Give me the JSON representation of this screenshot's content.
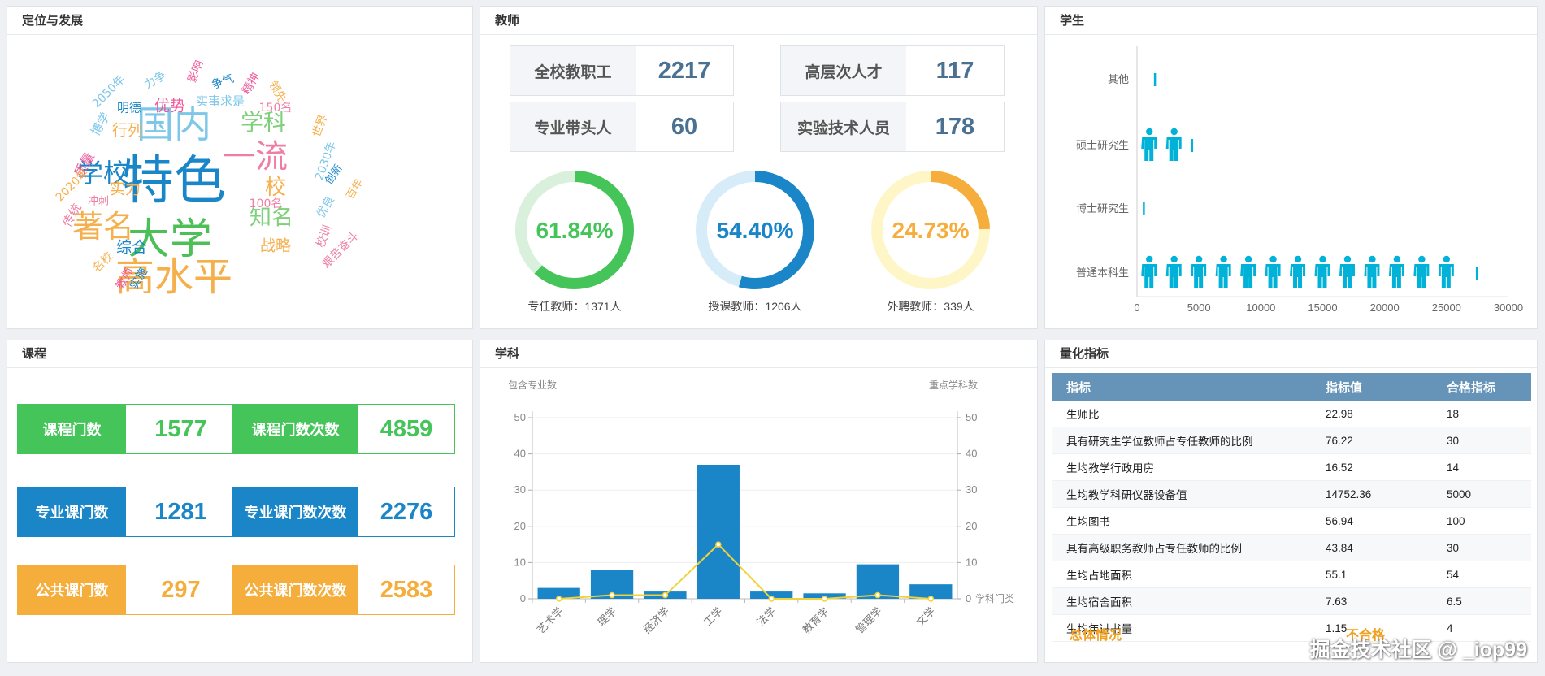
{
  "positioning": {
    "title": "定位与发展",
    "words": [
      {
        "text": "特色",
        "color": "#1a86c8"
      },
      {
        "text": "大学",
        "color": "#4cbf57"
      },
      {
        "text": "高水平",
        "color": "#f5b04d"
      },
      {
        "text": "国内",
        "color": "#7ec7e8"
      },
      {
        "text": "一流",
        "color": "#ee7fa3"
      },
      {
        "text": "著名",
        "color": "#f5b04d"
      },
      {
        "text": "学校",
        "color": "#1a86c8"
      },
      {
        "text": "学科",
        "color": "#7ed07a"
      },
      {
        "text": "知名",
        "color": "#7ed07a"
      },
      {
        "text": "校",
        "color": "#f5b04d"
      },
      {
        "text": "实力",
        "color": "#f5b04d"
      },
      {
        "text": "综合",
        "color": "#1a86c8"
      },
      {
        "text": "战略",
        "color": "#f5b04d"
      },
      {
        "text": "优势",
        "color": "#ee5a9a"
      },
      {
        "text": "行列",
        "color": "#f5b04d"
      },
      {
        "text": "明德",
        "color": "#1a86c8"
      },
      {
        "text": "实事求是",
        "color": "#7ec7e8"
      },
      {
        "text": "150名",
        "color": "#ee7fa3"
      },
      {
        "text": "质量",
        "color": "#ee5a9a"
      },
      {
        "text": "博学",
        "color": "#7ec7e8"
      },
      {
        "text": "2050年",
        "color": "#7ec7e8"
      },
      {
        "text": "力争",
        "color": "#7ec7e8"
      },
      {
        "text": "影响",
        "color": "#ee5a9a"
      },
      {
        "text": "争气",
        "color": "#1a86c8"
      },
      {
        "text": "精神",
        "color": "#ee5a9a"
      },
      {
        "text": "领先",
        "color": "#f5b04d"
      },
      {
        "text": "世界",
        "color": "#f5b04d"
      },
      {
        "text": "2030年",
        "color": "#7ec7e8"
      },
      {
        "text": "创新",
        "color": "#1a86c8"
      },
      {
        "text": "百年",
        "color": "#f5b04d"
      },
      {
        "text": "100名",
        "color": "#ee7fa3"
      },
      {
        "text": "优良",
        "color": "#7ec7e8"
      },
      {
        "text": "校训",
        "color": "#ee7fa3"
      },
      {
        "text": "艰苦奋斗",
        "color": "#ee7fa3"
      },
      {
        "text": "2020年",
        "color": "#f5b04d"
      },
      {
        "text": "冲刺",
        "color": "#ee7fa3"
      },
      {
        "text": "传统",
        "color": "#ee7fa3"
      },
      {
        "text": "名校",
        "color": "#f5b04d"
      },
      {
        "text": "教师",
        "color": "#ee5a9a"
      },
      {
        "text": "实施",
        "color": "#1a86c8"
      }
    ]
  },
  "teachers": {
    "title": "教师",
    "stats": [
      {
        "label": "全校教职工",
        "value": "2217"
      },
      {
        "label": "高层次人才",
        "value": "117"
      },
      {
        "label": "专业带头人",
        "value": "60"
      },
      {
        "label": "实验技术人员",
        "value": "178"
      }
    ],
    "rings": [
      {
        "percent": 61.84,
        "label": "61.84%",
        "caption": "专任教师：1371人",
        "color": "#45c45a",
        "track": "#d9f1dc"
      },
      {
        "percent": 54.4,
        "label": "54.40%",
        "caption": "授课教师：1206人",
        "color": "#1a86c8",
        "track": "#d6ecf8"
      },
      {
        "percent": 24.73,
        "label": "24.73%",
        "caption": "外聘教师：339人",
        "color": "#f5ad3b",
        "track": "#fff6c8"
      }
    ]
  },
  "students": {
    "title": "学生",
    "chart_data": {
      "type": "bar",
      "orientation": "horizontal",
      "categories": [
        "其他",
        "硕士研究生",
        "博士研究生",
        "普通本科生"
      ],
      "values": [
        1500,
        4500,
        600,
        27500
      ],
      "xlim": [
        0,
        30000
      ],
      "xticks": [
        "0",
        "5000",
        "10000",
        "15000",
        "20000",
        "25000",
        "30000"
      ],
      "color": "#00b2d8"
    }
  },
  "courses": {
    "title": "课程",
    "items": [
      {
        "label": "课程门数",
        "value": "1577",
        "color": "#45c45a"
      },
      {
        "label": "课程门数次数",
        "value": "4859",
        "color": "#45c45a"
      },
      {
        "label": "专业课门数",
        "value": "1281",
        "color": "#1a86c8"
      },
      {
        "label": "专业课门数次数",
        "value": "2276",
        "color": "#1a86c8"
      },
      {
        "label": "公共课门数",
        "value": "297",
        "color": "#f5ad3b"
      },
      {
        "label": "公共课门数次数",
        "value": "2583",
        "color": "#f5ad3b"
      }
    ]
  },
  "subjects": {
    "title": "学科",
    "chart_data": {
      "type": "bar",
      "categories": [
        "艺术学",
        "理学",
        "经济学",
        "工学",
        "法学",
        "教育学",
        "管理学",
        "文学"
      ],
      "ylabel_left": "包含专业数",
      "ylabel_right": "重点学科数",
      "right_axis_name": "学科门类",
      "ylim": [
        0,
        50
      ],
      "yticks": [
        "0",
        "10",
        "20",
        "30",
        "40",
        "50"
      ],
      "series": [
        {
          "name": "包含专业数",
          "type": "bar",
          "values": [
            3,
            8,
            2,
            37,
            2,
            1.5,
            9.5,
            4
          ],
          "color": "#1a86c8"
        },
        {
          "name": "重点学科数",
          "type": "line",
          "values": [
            0,
            1,
            1,
            15,
            0,
            0,
            1,
            0
          ],
          "color": "#f0d23a"
        }
      ]
    }
  },
  "quant": {
    "title": "量化指标",
    "headers": [
      "指标",
      "指标值",
      "合格指标"
    ],
    "rows": [
      {
        "name": "生师比",
        "value": "22.98",
        "std": "18",
        "warn": true
      },
      {
        "name": "具有研究生学位教师占专任教师的比例",
        "value": "76.22",
        "std": "30",
        "warn": false
      },
      {
        "name": "生均教学行政用房",
        "value": "16.52",
        "std": "14",
        "warn": false
      },
      {
        "name": "生均教学科研仪器设备值",
        "value": "14752.36",
        "std": "5000",
        "warn": false
      },
      {
        "name": "生均图书",
        "value": "56.94",
        "std": "100",
        "warn": true
      },
      {
        "name": "具有高级职务教师占专任教师的比例",
        "value": "43.84",
        "std": "30",
        "warn": false
      },
      {
        "name": "生均占地面积",
        "value": "55.1",
        "std": "54",
        "warn": false
      },
      {
        "name": "生均宿舍面积",
        "value": "7.63",
        "std": "6.5",
        "warn": false
      },
      {
        "name": "生均年进书量",
        "value": "1.15",
        "std": "4",
        "warn": true
      }
    ],
    "summary_label": "总体情况",
    "summary_value": "不合格"
  },
  "watermark": "掘金技术社区 @ _iop99"
}
